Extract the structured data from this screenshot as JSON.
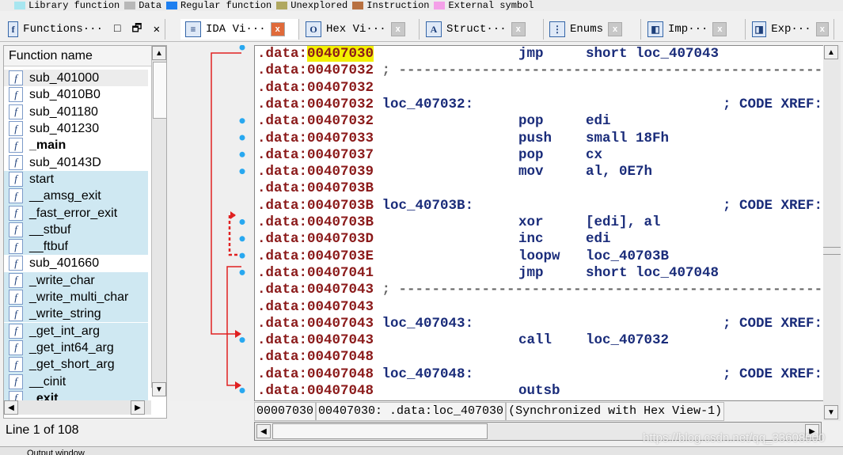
{
  "legend": [
    {
      "label": "Library function",
      "color": "#a8e6f0"
    },
    {
      "label": "Data",
      "color": "#b8b8b8"
    },
    {
      "label": "Regular function",
      "color": "#1e7ff0"
    },
    {
      "label": "Unexplored",
      "color": "#b0a860"
    },
    {
      "label": "Instruction",
      "color": "#b87040"
    },
    {
      "label": "External symbol",
      "color": "#f4a0e8"
    }
  ],
  "tabs": [
    {
      "label": "Functions···",
      "icon": "f"
    },
    {
      "label": "IDA Vi···",
      "icon": "≡"
    },
    {
      "label": "Hex Vi···",
      "icon": "O"
    },
    {
      "label": "Struct···",
      "icon": "A"
    },
    {
      "label": "Enums",
      "icon": "⋮"
    },
    {
      "label": "Imp···",
      "icon": "◧"
    },
    {
      "label": "Exp···",
      "icon": "◨"
    }
  ],
  "functions": {
    "header": "Function name",
    "status": "Line 1 of 108",
    "items": [
      {
        "name": "sub_401000",
        "lib": false
      },
      {
        "name": "sub_4010B0",
        "lib": false
      },
      {
        "name": "sub_401180",
        "lib": false
      },
      {
        "name": "sub_401230",
        "lib": false
      },
      {
        "name": "_main",
        "lib": false,
        "bold": true
      },
      {
        "name": "sub_40143D",
        "lib": false
      },
      {
        "name": "start",
        "lib": true
      },
      {
        "name": "__amsg_exit",
        "lib": true
      },
      {
        "name": "_fast_error_exit",
        "lib": true
      },
      {
        "name": "__stbuf",
        "lib": true
      },
      {
        "name": "__ftbuf",
        "lib": true
      },
      {
        "name": "sub_401660",
        "lib": false
      },
      {
        "name": "_write_char",
        "lib": true
      },
      {
        "name": "_write_multi_char",
        "lib": true
      },
      {
        "name": "_write_string",
        "lib": true
      },
      {
        "name": "_get_int_arg",
        "lib": true
      },
      {
        "name": "_get_int64_arg",
        "lib": true
      },
      {
        "name": "_get_short_arg",
        "lib": true
      },
      {
        "name": "__cinit",
        "lib": true
      },
      {
        "name": "_exit",
        "lib": true,
        "bold": true
      }
    ]
  },
  "code": [
    {
      "addr": ".data:00407030",
      "mn": "jmp",
      "op": "short loc_407043",
      "sel": true
    },
    {
      "addr": ".data:00407032",
      "sep": true
    },
    {
      "addr": ".data:00407032"
    },
    {
      "addr": ".data:00407032",
      "label": "loc_407032:",
      "xref": "; CODE XREF:"
    },
    {
      "addr": ".data:00407032",
      "mn": "pop",
      "op": "edi"
    },
    {
      "addr": ".data:00407033",
      "mn": "push",
      "op": "small 18Fh"
    },
    {
      "addr": ".data:00407037",
      "mn": "pop",
      "op": "cx"
    },
    {
      "addr": ".data:00407039",
      "mn": "mov",
      "op": "al, 0E7h"
    },
    {
      "addr": ".data:0040703B"
    },
    {
      "addr": ".data:0040703B",
      "label": "loc_40703B:",
      "xref": "; CODE XREF:"
    },
    {
      "addr": ".data:0040703B",
      "mn": "xor",
      "op": "[edi], al"
    },
    {
      "addr": ".data:0040703D",
      "mn": "inc",
      "op": "edi"
    },
    {
      "addr": ".data:0040703E",
      "mn": "loopw",
      "op": "loc_40703B"
    },
    {
      "addr": ".data:00407041",
      "mn": "jmp",
      "op": "short loc_407048"
    },
    {
      "addr": ".data:00407043",
      "sep": true
    },
    {
      "addr": ".data:00407043"
    },
    {
      "addr": ".data:00407043",
      "label": "loc_407043:",
      "xref": "; CODE XREF:"
    },
    {
      "addr": ".data:00407043",
      "mn": "call",
      "op": "loc_407032"
    },
    {
      "addr": ".data:00407048"
    },
    {
      "addr": ".data:00407048",
      "label": "loc_407048:",
      "xref": "; CODE XREF:"
    },
    {
      "addr": ".data:00407048",
      "mn": "outsb"
    }
  ],
  "status": {
    "offset": "00007030",
    "location": "00407030: .data:loc_407030",
    "sync": "(Synchronized with Hex View-1)"
  },
  "watermark": "https://blog.csdn.net/qq_33608000",
  "output_title": "Output window"
}
